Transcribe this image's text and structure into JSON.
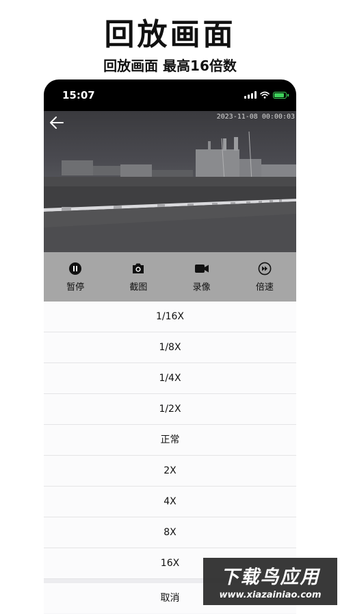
{
  "promo": {
    "title": "回放画面",
    "subtitle": "回放画面  最高16倍数"
  },
  "status_bar": {
    "time": "15:07",
    "icons": [
      "cellular-signal-icon",
      "wifi-icon",
      "battery-charging-icon"
    ]
  },
  "video": {
    "timestamp": "2023-11-08 00:00:03",
    "back_icon": "arrow-left-icon"
  },
  "toolbar": {
    "items": [
      {
        "label": "暂停",
        "icon": "pause-icon"
      },
      {
        "label": "截图",
        "icon": "camera-icon"
      },
      {
        "label": "录像",
        "icon": "video-camera-icon"
      },
      {
        "label": "倍速",
        "icon": "fast-forward-icon"
      }
    ]
  },
  "speed_menu": {
    "options": [
      "1/16X",
      "1/8X",
      "1/4X",
      "1/2X",
      "正常",
      "2X",
      "4X",
      "8X",
      "16X"
    ],
    "cancel": "取消"
  },
  "watermark": {
    "brand": "下载鸟应用",
    "url": "www.xiazainiao.com"
  },
  "colors": {
    "toolbar_bg": "#a6a6a6",
    "sheet_bg": "#fbfbfc",
    "battery": "#3ed15a"
  }
}
